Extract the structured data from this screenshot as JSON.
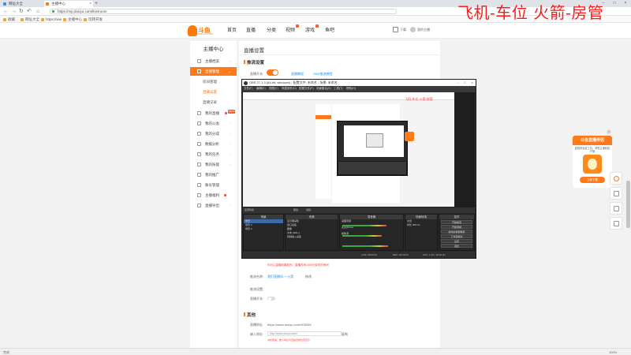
{
  "browser": {
    "tabs": [
      {
        "label": "网址大全",
        "active": false
      },
      {
        "label": "主播中心",
        "active": true
      }
    ],
    "new_tab": "+",
    "window_controls": [
      "–",
      "□",
      "×"
    ],
    "url": "https://mp.douyu.com/live/room",
    "bookmarks": [
      "收藏",
      "网址大全",
      "https://ww",
      "主播中心",
      "玩转开发"
    ]
  },
  "overlay_text": "飞机-车位  火箭-房管",
  "site": {
    "logo_text": "斗鱼",
    "logo_sub": "DOUYU.COM",
    "nav": [
      "首页",
      "直播",
      "分类",
      "视频",
      "游戏",
      "鱼吧"
    ],
    "header_right": {
      "download": "下载",
      "user": "我的主播"
    }
  },
  "sidebar": {
    "title": "主播中心",
    "items": [
      {
        "label": "主播档案",
        "active": false
      },
      {
        "label": "直播管理",
        "active": true
      },
      {
        "label": "我的直播",
        "active": false
      },
      {
        "label": "我的公会",
        "active": false
      },
      {
        "label": "我的分成",
        "active": false
      },
      {
        "label": "数据分析",
        "active": false
      },
      {
        "label": "我的任务",
        "active": false
      },
      {
        "label": "我的技能",
        "active": false
      },
      {
        "label": "我的推广",
        "active": false
      },
      {
        "label": "账号管理",
        "active": false
      },
      {
        "label": "主播福利",
        "active": false
      },
      {
        "label": "直播导出",
        "active": false
      }
    ],
    "subitems": [
      {
        "label": "房间管理",
        "selected": false
      },
      {
        "label": "直播设置",
        "selected": true
      },
      {
        "label": "直播记录",
        "selected": false
      }
    ],
    "new_badge": "NEW"
  },
  "main": {
    "title": "直播设置",
    "section1": "推流设置",
    "push_label": "直播开关:",
    "link1": "直播教程",
    "link2": "OBS推流教程",
    "warning": "你可以直播到最新的、直播时间1500分钟内的房间",
    "room_label": "推流名称:",
    "room_link": "我们直播间-一火箭",
    "room_edit": "修改",
    "setting_label": "推流设置:",
    "live_switch_label": "直播开关:",
    "section2": "其他",
    "addr_label": "直播地址:",
    "addr_value": "https://www.douyu.com/905948",
    "code_label": "嵌入地址:",
    "code_value": "http://www.douyu.com/",
    "code_button": "复制",
    "code_hint": "请勿泄露，嵌入地址可自由定制位置显示"
  },
  "obs": {
    "title": "OBS 27.1.3 (64-bit, windows) - 配置文件: 未命名 - 场景: 未命名",
    "menu": [
      "文件(F)",
      "编辑(E)",
      "视图(V)",
      "停靠部件(D)",
      "配置文件(P)",
      "场景集合(S)",
      "工具(T)",
      "帮助(H)"
    ],
    "toolbar": [
      "来源列表",
      "属性",
      "滤镜"
    ],
    "docks": {
      "scenes": {
        "title": "场景",
        "items": [
          "场景",
          "场景 2",
          "场景 3"
        ]
      },
      "sources": {
        "title": "来源",
        "items": [
          "显示器采集",
          "窗口采集",
          "图像",
          "文本 (GDI+)",
          "音频输入采集"
        ]
      },
      "mixer": {
        "title": "混音器",
        "channels": [
          "桌面音频",
          "麦克风/Aux",
          "媒体源"
        ]
      },
      "transitions": {
        "title": "场景转场",
        "items": [
          "淡出",
          "时长 300 ms"
        ]
      },
      "controls": {
        "title": "控件",
        "buttons": [
          "开始推流",
          "开始录制",
          "启动虚拟摄像机",
          "工作室模式",
          "设置",
          "退出"
        ]
      }
    },
    "status": [
      "LIVE: 00:00:00",
      "REC: 00:00:00",
      "CPU: 1.2%, 30.00 fps"
    ]
  },
  "promo": {
    "title": "斗鱼直播伴侣",
    "text": "超强的免费工具，帮助主播轻松开播",
    "button": "立即下载",
    "close": "×"
  },
  "statusbar": {
    "left": "完成",
    "right": "100%"
  }
}
